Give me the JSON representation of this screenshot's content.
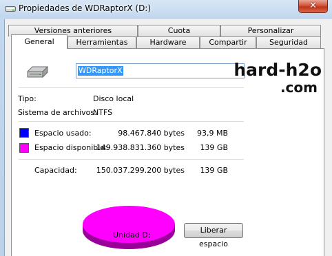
{
  "window": {
    "title": "Propiedades de WDRaptorX (D:)"
  },
  "tabs": {
    "row1": [
      "Versiones anteriores",
      "Cuota",
      "Personalizar"
    ],
    "row2": [
      "General",
      "Herramientas",
      "Hardware",
      "Compartir",
      "Seguridad"
    ],
    "active": "General"
  },
  "general": {
    "drive_name": "WDRaptorX",
    "type_label": "Tipo:",
    "type_value": "Disco local",
    "fs_label": "Sistema de archivos:",
    "fs_value": "NTFS",
    "used_label": "Espacio usado:",
    "used_bytes": "98.467.840 bytes",
    "used_size": "93,9 MB",
    "free_label": "Espacio disponible:",
    "free_bytes": "149.938.831.360 bytes",
    "free_size": "139 GB",
    "capacity_label": "Capacidad:",
    "capacity_bytes": "150.037.299.200 bytes",
    "capacity_size": "139 GB",
    "drive_label": "Unidad D:",
    "cleanup_button": "Liberar espacio"
  },
  "watermark": {
    "line1": "hard-h2o",
    "line2": ".com"
  },
  "colors": {
    "used": "#0000ff",
    "free": "#ff00ff",
    "free_shade": "#990099"
  },
  "icons": [
    "drive-icon",
    "close-icon",
    "window-icon"
  ]
}
